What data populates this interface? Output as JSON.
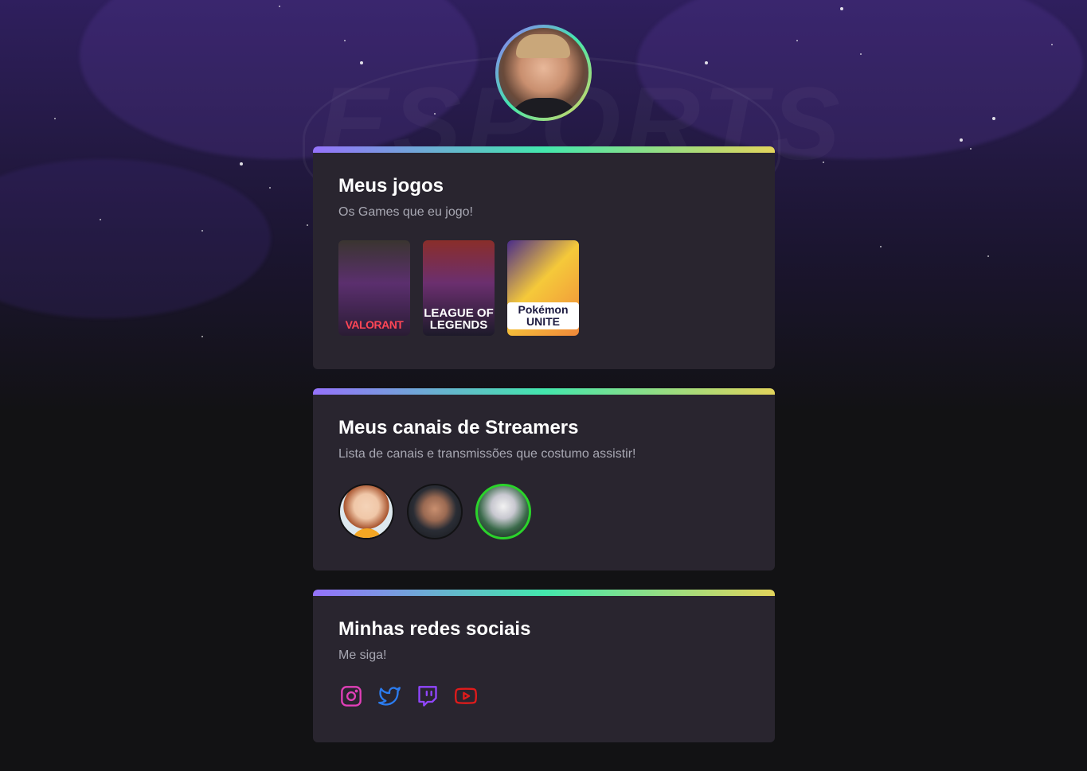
{
  "profile": {
    "avatar_alt": "Foto de perfil"
  },
  "games_card": {
    "title": "Meus jogos",
    "subtitle": "Os Games que eu jogo!",
    "games": [
      {
        "name": "VALORANT"
      },
      {
        "name": "LEAGUE OF LEGENDS"
      },
      {
        "name": "Pokémon UNITE"
      }
    ]
  },
  "streamers_card": {
    "title": "Meus canais de Streamers",
    "subtitle": "Lista de canais e transmissões que costumo assistir!"
  },
  "social_card": {
    "title": "Minhas redes sociais",
    "subtitle": "Me siga!",
    "icons": [
      {
        "name": "instagram-icon",
        "color": "#e13fb8"
      },
      {
        "name": "twitter-icon",
        "color": "#2b7cf0"
      },
      {
        "name": "twitch-icon",
        "color": "#9146ff"
      },
      {
        "name": "youtube-icon",
        "color": "#e01b1b"
      }
    ]
  },
  "colors": {
    "gradient_start": "#9572fc",
    "gradient_mid": "#43e7ad",
    "gradient_end": "#e2d45c",
    "card_bg": "#29252f",
    "page_bg": "#121214"
  }
}
